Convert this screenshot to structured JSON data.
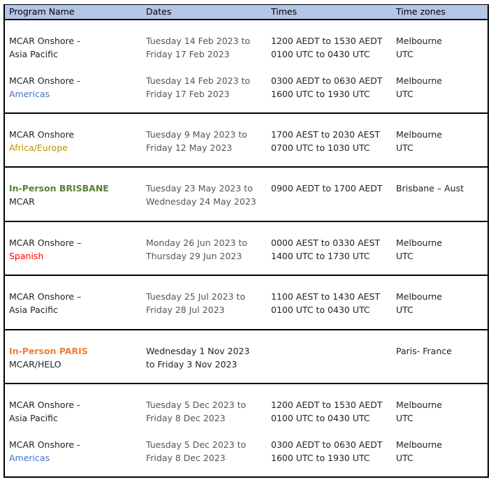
{
  "header": {
    "program_name": "Program Name",
    "dates": "Dates",
    "times": "Times",
    "time_zones": "Time zones"
  },
  "rows": [
    {
      "entries": [
        {
          "name1": "MCAR Onshore -",
          "name2": "Asia Pacific",
          "date1": "Tuesday 14 Feb 2023 to",
          "date2": "Friday 17 Feb 2023",
          "time1": "1200 AEDT to 1530 AEDT",
          "time2": "0100 UTC to 0430 UTC",
          "tz1": "Melbourne",
          "tz2": "UTC"
        },
        {
          "name1": "MCAR Onshore -",
          "name2": "Americas",
          "date1": "Tuesday 14 Feb 2023 to",
          "date2": "Friday 17 Feb 2023",
          "time1": "0300 AEDT to 0630 AEDT",
          "time2": "1600 UTC to 1930 UTC",
          "tz1": "Melbourne",
          "tz2": "UTC"
        }
      ]
    },
    {
      "entries": [
        {
          "name1": "MCAR Onshore",
          "name2": "Africa/Europe",
          "date1": "Tuesday 9 May 2023 to",
          "date2": "Friday 12 May 2023",
          "time1": "1700 AEST to 2030 AEST",
          "time2": "0700 UTC to 1030 UTC",
          "tz1": "Melbourne",
          "tz2": "UTC"
        }
      ]
    },
    {
      "entries": [
        {
          "name1": "In-Person BRISBANE",
          "name2": "MCAR",
          "date1": "Tuesday 23 May 2023 to",
          "date2": "Wednesday 24 May 2023",
          "time1": "0900 AEDT to 1700 AEDT",
          "time2": "",
          "tz1": "Brisbane – Aust",
          "tz2": ""
        }
      ]
    },
    {
      "entries": [
        {
          "name1": "MCAR Onshore –",
          "name2": "Spanish",
          "date1": "Monday 26 Jun 2023 to",
          "date2": "Thursday 29 Jun 2023",
          "time1": "0000 AEST to 0330 AEST",
          "time2": "1400 UTC to 1730 UTC",
          "tz1": "Melbourne",
          "tz2": "UTC"
        }
      ]
    },
    {
      "entries": [
        {
          "name1": "MCAR Onshore –",
          "name2": "Asia Pacific",
          "date1": "Tuesday 25 Jul 2023 to",
          "date2": "Friday 28 Jul 2023",
          "time1": "1100 AEST to 1430 AEST",
          "time2": "0100 UTC to 0430 UTC",
          "tz1": "Melbourne",
          "tz2": "UTC"
        }
      ]
    },
    {
      "entries": [
        {
          "name1": "In-Person PARIS",
          "name2": "MCAR/HELO",
          "date1": "Wednesday 1 Nov 2023",
          "date2": "to Friday 3 Nov 2023",
          "time1": "",
          "time2": "",
          "tz1": "Paris- France",
          "tz2": ""
        }
      ]
    },
    {
      "entries": [
        {
          "name1": "MCAR Onshore -",
          "name2": "Asia Pacific",
          "date1": "Tuesday 5 Dec 2023 to",
          "date2": "Friday 8 Dec 2023",
          "time1": "1200 AEDT to 1530 AEDT",
          "time2": "0100 UTC to 0430 UTC",
          "tz1": "Melbourne",
          "tz2": "UTC"
        },
        {
          "name1": "MCAR Onshore -",
          "name2": "Americas",
          "date1": "Tuesday 5 Dec 2023 to",
          "date2": "Friday 8 Dec 2023",
          "time1": "0300 AEDT to 0630 AEDT",
          "time2": "1600 UTC to 1930 UTC",
          "tz1": "Melbourne",
          "tz2": "UTC"
        }
      ]
    }
  ],
  "colors": {
    "header_background": "#b4c6e7",
    "americas_blue": "#4472c4",
    "africa_europe_gold": "#bf9000",
    "brisbane_green": "#548235",
    "spanish_red": "#ff0000",
    "paris_orange": "#ed7d31"
  }
}
